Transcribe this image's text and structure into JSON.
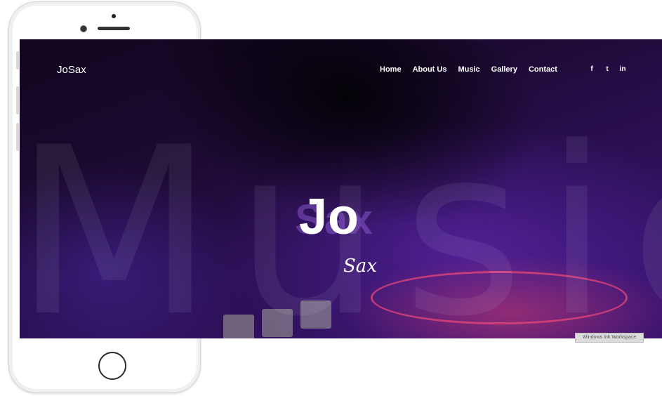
{
  "site": {
    "logo": "JoSax",
    "nav": [
      "Home",
      "About Us",
      "Music",
      "Gallery",
      "Contact"
    ],
    "social": [
      {
        "icon": "facebook-icon",
        "glyph": "f"
      },
      {
        "icon": "twitter-icon",
        "glyph": "t"
      },
      {
        "icon": "linkedin-icon",
        "glyph": "in"
      }
    ],
    "background_word": "Music",
    "hero": {
      "title": "Jo",
      "title_shadow": "Sax",
      "subtitle": "Sax"
    }
  },
  "overlay": {
    "watermark": "Windows Ink Workspace"
  },
  "colors": {
    "accent_purple": "#3a1470",
    "turntable_pink": "#e64678"
  }
}
